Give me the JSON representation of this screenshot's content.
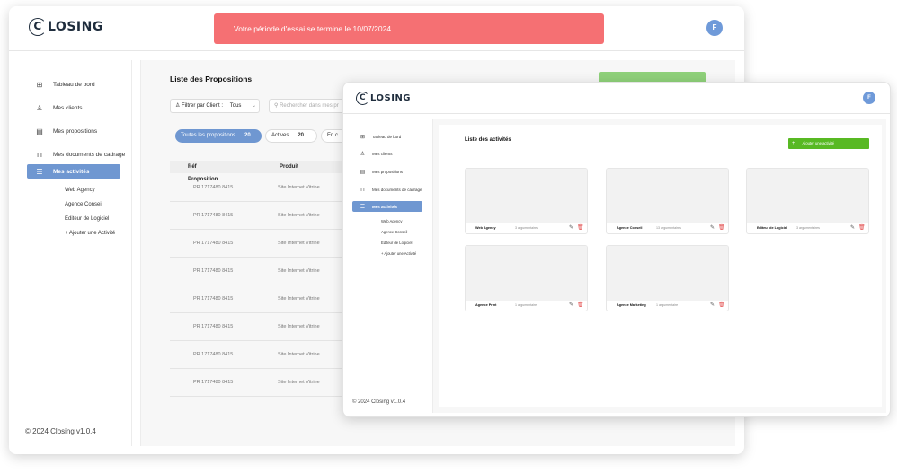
{
  "app": {
    "logo": "CLOSING",
    "logo_letter": "C",
    "logo_rest": "LOSING",
    "avatar": "F"
  },
  "back": {
    "trial_banner": "Votre période d'essai se termine le 10/07/2024",
    "sidebar": {
      "items": [
        {
          "icon": "dashboard-icon",
          "label": "Tableau de bord"
        },
        {
          "icon": "user-icon",
          "label": "Mes clients"
        },
        {
          "icon": "document-icon",
          "label": "Mes propositions"
        },
        {
          "icon": "book-icon",
          "label": "Mes documents de cadrage"
        },
        {
          "icon": "list-icon",
          "label": "Mes activités"
        }
      ],
      "sub_items": [
        "Web Agency",
        "Agence Conseil",
        "Editeur de Logiciel",
        "+ Ajouter une Activité"
      ],
      "footer": "© 2024 Closing v1.0.4"
    },
    "main": {
      "title": "Liste des Propositions",
      "filter_label": "Filtrer par Client :",
      "filter_value": "Tous",
      "search_placeholder": "Rechercher dans mes pr",
      "tabs": [
        {
          "label": "Toutes les propositions",
          "count": "20"
        },
        {
          "label": "Actives",
          "count": "20"
        },
        {
          "label": "En c",
          "count": ""
        }
      ],
      "columns": [
        "Réf Proposition",
        "Produit"
      ],
      "rows": [
        [
          "PR 1717480 8415",
          "Site Internet Vitrine"
        ],
        [
          "PR 1717480 8415",
          "Site Internet Vitrine"
        ],
        [
          "PR 1717480 8415",
          "Site Internet Vitrine"
        ],
        [
          "PR 1717480 8415",
          "Site Internet Vitrine"
        ],
        [
          "PR 1717480 8415",
          "Site Internet Vitrine"
        ],
        [
          "PR 1717480 8415",
          "Site Internet Vitrine"
        ],
        [
          "PR 1717480 8415",
          "Site Internet Vitrine"
        ],
        [
          "PR 1717480 8415",
          "Site Internet Vitrine"
        ]
      ]
    }
  },
  "front": {
    "sidebar": {
      "items": [
        {
          "icon": "dashboard-icon",
          "label": "Tableau de bord"
        },
        {
          "icon": "user-icon",
          "label": "Mes clients"
        },
        {
          "icon": "document-icon",
          "label": "Mes propositions"
        },
        {
          "icon": "book-icon",
          "label": "Mes documents de cadrage"
        },
        {
          "icon": "list-icon",
          "label": "Mes activités"
        }
      ],
      "sub_items": [
        "Web Agency",
        "Agence Conseil",
        "Editeur de Logiciel",
        "+ Ajouter une Activité"
      ],
      "footer": "© 2024 Closing v1.0.4"
    },
    "main": {
      "title": "Liste des activités",
      "add_button": "Ajouter une activité",
      "cards": [
        {
          "name": "Web Agency",
          "count": "3 argumentaires"
        },
        {
          "name": "Agence Conseil",
          "count": "13 argumentaires"
        },
        {
          "name": "Editeur de Logiciel",
          "count": "3 argumentaires"
        },
        {
          "name": "Agence Print",
          "count": "1 argumentaire"
        },
        {
          "name": "Agence Marketing",
          "count": "1 argumentaire"
        }
      ]
    }
  }
}
